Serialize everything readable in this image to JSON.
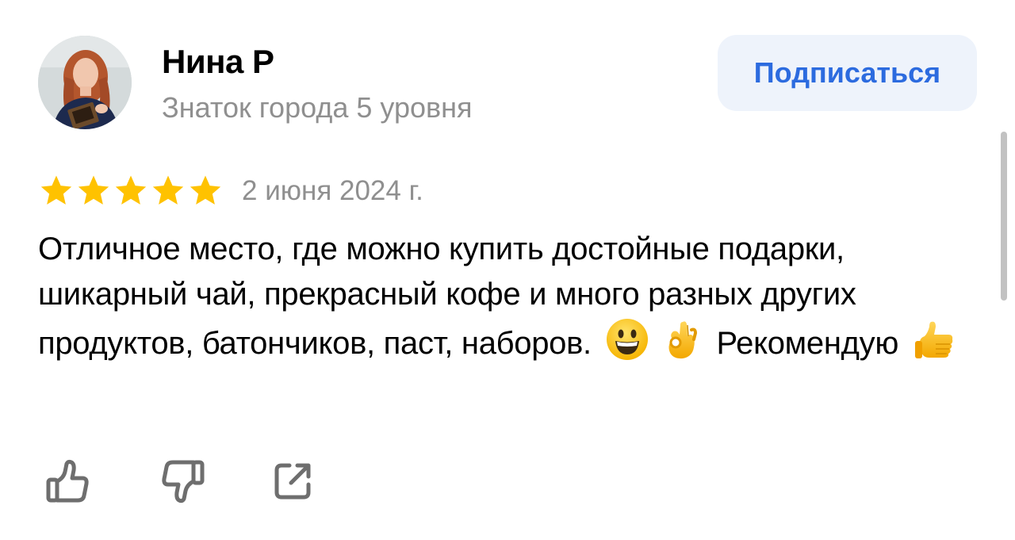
{
  "author": {
    "name": "Нина Р",
    "level": "Знаток города 5 уровня",
    "avatar_icon": "avatar-photo"
  },
  "subscribe": {
    "label": "Подписаться"
  },
  "review": {
    "rating": 5,
    "rating_max": 5,
    "date": "2 июня 2024 г.",
    "text_main": "Отличное место, где можно купить достойные подарки, шикарный чай, прекрасный кофе и много разных других продуктов, батончиков, паст, наборов.",
    "text_tail": "Рекомендую",
    "emojis": [
      "grinning-face",
      "ok-hand",
      "thumbs-up"
    ]
  },
  "actions": {
    "like_icon": "thumbs-up-outline-icon",
    "dislike_icon": "thumbs-down-outline-icon",
    "share_icon": "share-icon"
  },
  "colors": {
    "accent": "#2c6bdf",
    "button_bg": "#eef3fb",
    "star": "#ffc200",
    "muted_text": "#8f8f8f",
    "icon_gray": "#6e6e6e"
  }
}
